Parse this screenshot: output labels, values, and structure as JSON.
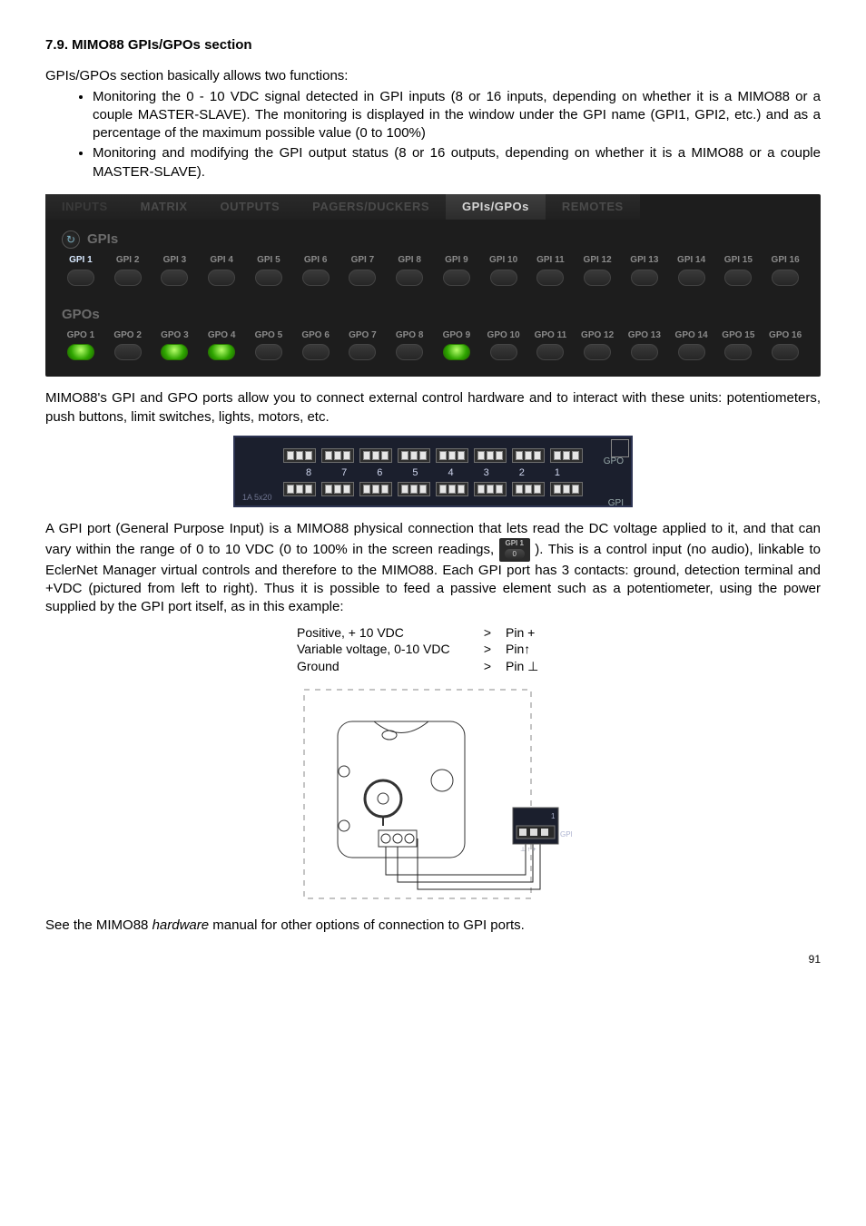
{
  "heading": "7.9. MIMO88 GPIs/GPOs section",
  "intro": "GPIs/GPOs section basically allows two functions:",
  "bullets": [
    "Monitoring the 0 - 10 VDC signal detected in GPI inputs (8 or 16 inputs, depending on whether it is a MIMO88 or a couple MASTER-SLAVE). The monitoring is displayed in the window under the GPI name (GPI1, GPI2, etc.) and as a percentage of the maximum possible value (0 to 100%)",
    "Monitoring and modifying the GPI output status (8 or 16 outputs, depending on whether it is a MIMO88 or a couple MASTER-SLAVE)."
  ],
  "tabs": {
    "inputs": "INPUTS",
    "matrix": "MATRIX",
    "outputs": "OUTPUTS",
    "pagers": "PAGERS/DUCKERS",
    "gpis": "GPIs/GPOs",
    "remotes": "REMOTES"
  },
  "groups": {
    "gpis_title": "GPIs",
    "gpos_title": "GPOs"
  },
  "gpi_ports": [
    "GPI 1",
    "GPI 2",
    "GPI 3",
    "GPI 4",
    "GPI 5",
    "GPI 6",
    "GPI 7",
    "GPI 8",
    "GPI 9",
    "GPI 10",
    "GPI 11",
    "GPI 12",
    "GPI 13",
    "GPI 14",
    "GPI 15",
    "GPI 16"
  ],
  "gpo_ports": [
    "GPO 1",
    "GPO 2",
    "GPO 3",
    "GPO 4",
    "GPO 5",
    "GPO 6",
    "GPO 7",
    "GPO 8",
    "GPO 9",
    "GPO 10",
    "GPO 11",
    "GPO 12",
    "GPO 13",
    "GPO 14",
    "GPO 15",
    "GPO 16"
  ],
  "gpo_green": [
    0,
    2,
    3,
    8
  ],
  "para_after_panel": "MIMO88's GPI and GPO ports allow you to connect external control hardware and to interact with these units: potentiometers, push buttons, limit switches, lights, motors, etc.",
  "connector_nums": [
    "8",
    "7",
    "6",
    "5",
    "4",
    "3",
    "2",
    "1"
  ],
  "connector_labels": {
    "gpo": "GPO",
    "gpi": "GPI",
    "rating": "1A 5x20"
  },
  "para_gpi_1": "A GPI port (General Purpose Input) is a MIMO88 physical connection that lets read the DC voltage applied to it, and that can vary within the range of 0 to 10 VDC (0 to 100% in the screen readings, ",
  "para_gpi_2": "). This is a control input (no audio), linkable to EclerNet Manager virtual controls and therefore to the MIMO88. Each GPI port has 3 contacts: ground, detection terminal and +VDC (pictured from left to right). Thus it is possible to feed a passive element such as a potentiometer, using the power supplied by the GPI port itself, as in this example:",
  "badge": {
    "label": "GPI 1",
    "value": "0"
  },
  "pin_rows": [
    {
      "name": "Positive, + 10 VDC",
      "arrow": ">",
      "pin": "Pin +"
    },
    {
      "name": "Variable voltage, 0-10 VDC",
      "arrow": ">",
      "pin": "Pin↑"
    },
    {
      "name": "Ground",
      "arrow": ">",
      "pin": "Pin ⊥"
    }
  ],
  "closing": "See the MIMO88 hardware manual for other options of connection to GPI ports.",
  "closing_pre": "See the MIMO88 ",
  "closing_em": "hardware",
  "closing_post": " manual for other options of connection to GPI ports.",
  "pagenum": "91"
}
